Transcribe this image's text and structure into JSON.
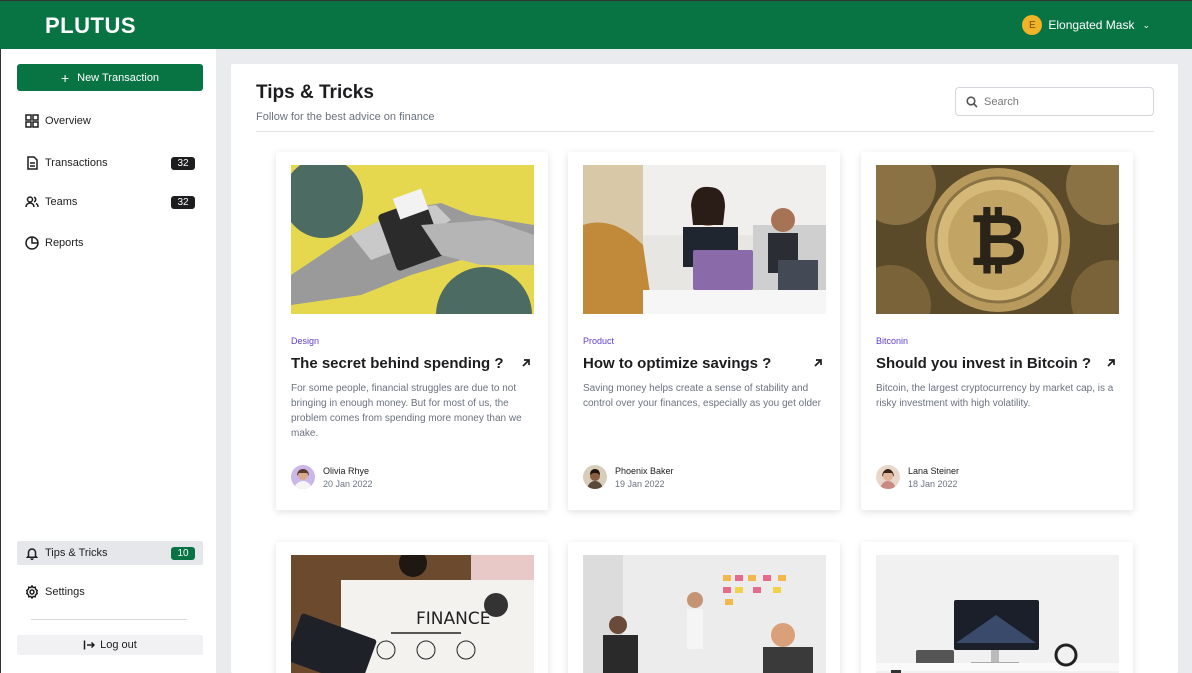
{
  "app": {
    "logo": "PLUTUS"
  },
  "user": {
    "initial": "E",
    "name": "Elongated Mask"
  },
  "sidebar": {
    "new_transaction": "New Transaction",
    "items": [
      {
        "label": "Overview"
      },
      {
        "label": "Transactions",
        "badge": "32"
      },
      {
        "label": "Teams",
        "badge": "32"
      },
      {
        "label": "Reports"
      }
    ],
    "tips": {
      "label": "Tips & Tricks",
      "badge": "10"
    },
    "settings": "Settings",
    "logout": "Log out"
  },
  "page": {
    "title": "Tips & Tricks",
    "subtitle": "Follow for the best advice on finance",
    "search_placeholder": "Search"
  },
  "cards": [
    {
      "category": "Design",
      "title": "The secret behind spending ?",
      "description": "For some people, financial struggles are due to not bringing in enough money. But for most of us, the problem comes from spending more money than we make.",
      "author": "Olivia Rhye",
      "date": "20 Jan 2022"
    },
    {
      "category": "Product",
      "title": "How to optimize savings ?",
      "description": "Saving money helps create a sense of stability and control over your finances, especially as you get older",
      "author": "Phoenix Baker",
      "date": "19 Jan 2022"
    },
    {
      "category": "Bitconin",
      "title": "Should you invest in Bitcoin ?",
      "description": "Bitcoin, the largest cryptocurrency by market cap, is a risky investment with high volatility.",
      "author": "Lana Steiner",
      "date": "18 Jan 2022"
    }
  ],
  "second_row": {
    "finance_sign": "FINANCE"
  },
  "colors": {
    "brand": "#087443",
    "category": "#5b3fd0"
  }
}
